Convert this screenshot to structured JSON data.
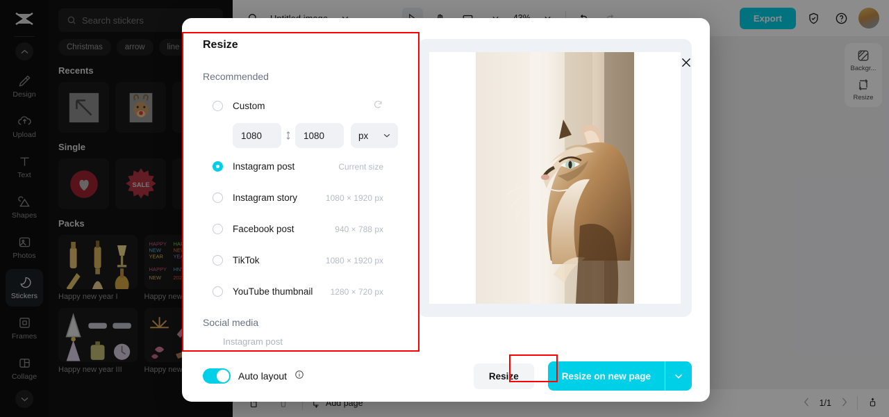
{
  "rail": {
    "logo_icon": "app-logo-icon",
    "collapse_icon": "chevron-up-icon",
    "expand_icon": "chevron-down-icon",
    "items": [
      {
        "label": "Design",
        "icon": "design-icon",
        "active": false
      },
      {
        "label": "Upload",
        "icon": "upload-cloud-icon",
        "active": false
      },
      {
        "label": "Text",
        "icon": "text-icon",
        "active": false
      },
      {
        "label": "Shapes",
        "icon": "shapes-icon",
        "active": false
      },
      {
        "label": "Photos",
        "icon": "photos-icon",
        "active": false
      },
      {
        "label": "Stickers",
        "icon": "stickers-icon",
        "active": true
      },
      {
        "label": "Frames",
        "icon": "frames-icon",
        "active": false
      },
      {
        "label": "Collage",
        "icon": "collage-icon",
        "active": false
      }
    ]
  },
  "panel": {
    "search_placeholder": "Search stickers",
    "search_icon": "search-icon",
    "tags": [
      "Christmas",
      "arrow",
      "line"
    ],
    "sections": [
      {
        "title": "Recents"
      },
      {
        "title": "Single"
      },
      {
        "title": "Packs"
      }
    ],
    "packs": [
      {
        "label": "Happy new year I"
      },
      {
        "label": "Happy new year II"
      },
      {
        "label": "Happy new year III"
      },
      {
        "label": "Happy new year IV"
      }
    ]
  },
  "topbar": {
    "search_icon": "search-icon",
    "doc_title": "Untitled image",
    "title_chevron": "chevron-down-icon",
    "tools": [
      "cursor-icon",
      "hand-icon",
      "crop-icon"
    ],
    "crop_chevron": "chevron-down-icon",
    "zoom_level": "43%",
    "zoom_chevron": "chevron-down-icon",
    "undo_icon": "undo-icon",
    "redo_icon": "redo-icon",
    "export_label": "Export",
    "shield_icon": "shield-check-icon",
    "help_icon": "help-circle-icon",
    "avatar": "user-avatar"
  },
  "rightdock": {
    "items": [
      {
        "label": "Backgr...",
        "icon": "background-icon"
      },
      {
        "label": "Resize",
        "icon": "resize-icon"
      }
    ]
  },
  "bottombar": {
    "duplicate_icon": "duplicate-page-icon",
    "delete_icon": "delete-page-icon",
    "add_page_icon": "add-page-icon",
    "add_page_label": "Add page",
    "prev_icon": "chevron-left-icon",
    "page_indicator": "1/1",
    "next_icon": "chevron-right-icon",
    "fullscreen_icon": "expand-icon"
  },
  "modal": {
    "title": "Resize",
    "close_icon": "close-icon",
    "group_recommended": "Recommended",
    "group_social": "Social media",
    "reset_icon": "reset-icon",
    "link_icon": "link-dimensions-icon",
    "unit_value": "px",
    "unit_chevron": "chevron-down-icon",
    "width_value": "1080",
    "height_value": "1080",
    "options": [
      {
        "label": "Custom",
        "size": "",
        "selected": false
      },
      {
        "label": "Instagram post",
        "size": "Current size",
        "selected": true
      },
      {
        "label": "Instagram story",
        "size": "1080 × 1920 px",
        "selected": false
      },
      {
        "label": "Facebook post",
        "size": "940 × 788 px",
        "selected": false
      },
      {
        "label": "TikTok",
        "size": "1080 × 1920 px",
        "selected": false
      },
      {
        "label": "YouTube thumbnail",
        "size": "1280 × 720 px",
        "selected": false
      }
    ],
    "social_items": [
      "Instagram post"
    ],
    "auto_layout_label": "Auto layout",
    "auto_layout_info_icon": "info-icon",
    "auto_layout_on": true,
    "resize_label": "Resize",
    "resize_new_page_label": "Resize on new page",
    "resize_new_page_chevron": "chevron-down-icon"
  },
  "colors": {
    "accent_cyan": "#00cfe8",
    "highlight_red": "#ff0000",
    "panel_dark": "#111111",
    "rail_dark": "#0d0d0d"
  }
}
